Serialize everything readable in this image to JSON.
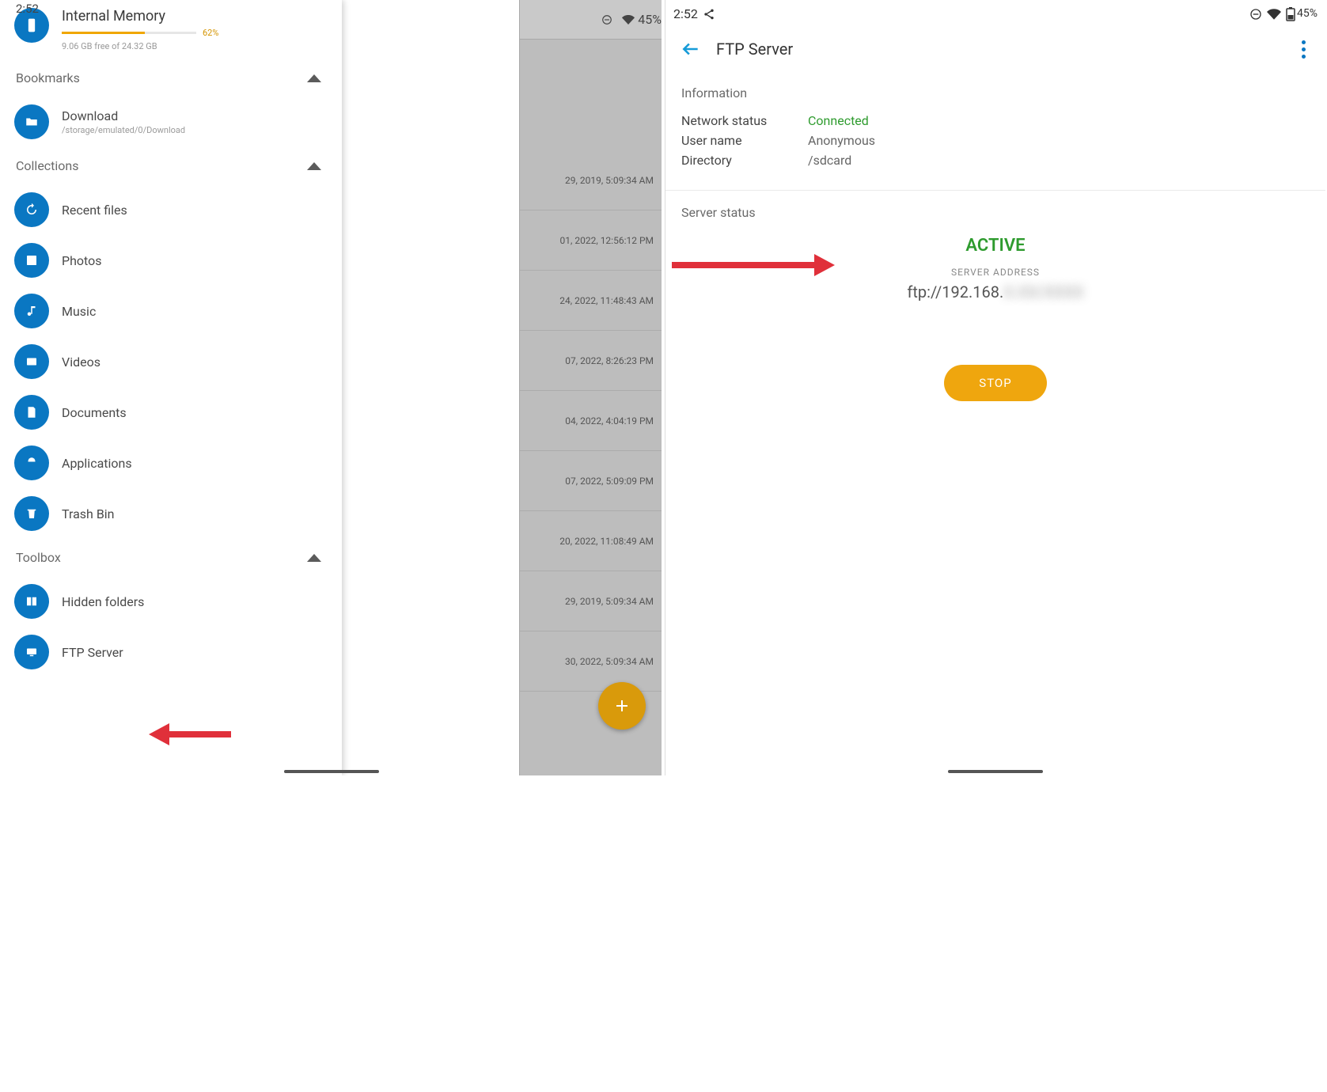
{
  "status": {
    "time": "2:52",
    "battery": "45%"
  },
  "left": {
    "share_glyph": "<",
    "memory": {
      "title": "Internal Memory",
      "percent_text": "62%",
      "percent_width": 62,
      "sub": "9.06 GB free of 24.32 GB"
    },
    "sections": {
      "bookmarks": "Bookmarks",
      "collections": "Collections",
      "toolbox": "Toolbox"
    },
    "bookmark_items": [
      {
        "label": "Download",
        "sub": "/storage/emulated/0/Download"
      }
    ],
    "collection_items": [
      {
        "label": "Recent files"
      },
      {
        "label": "Photos"
      },
      {
        "label": "Music"
      },
      {
        "label": "Videos"
      },
      {
        "label": "Documents"
      },
      {
        "label": "Applications"
      },
      {
        "label": "Trash Bin"
      }
    ],
    "toolbox_items": [
      {
        "label": "Hidden folders"
      },
      {
        "label": "FTP Server"
      }
    ],
    "bg_rows": [
      "29, 2019, 5:09:34 AM",
      "01, 2022, 12:56:12 PM",
      "24, 2022, 11:48:43 AM",
      "07, 2022, 8:26:23 PM",
      "04, 2022, 4:04:19 PM",
      "07, 2022, 5:09:09 PM",
      "20, 2022, 11:08:49 AM",
      "29, 2019, 5:09:34 AM",
      "30, 2022, 5:09:34 AM"
    ]
  },
  "right": {
    "title": "FTP Server",
    "info_heading": "Information",
    "network_status_label": "Network status",
    "network_status_value": "Connected",
    "username_label": "User name",
    "username_value": "Anonymous",
    "directory_label": "Directory",
    "directory_value": "/sdcard",
    "server_heading": "Server status",
    "active_text": "ACTIVE",
    "addr_label": "SERVER ADDRESS",
    "addr_visible": "ftp://192.168.",
    "addr_hidden": "X.XX/XXXX",
    "stop_label": "STOP"
  }
}
